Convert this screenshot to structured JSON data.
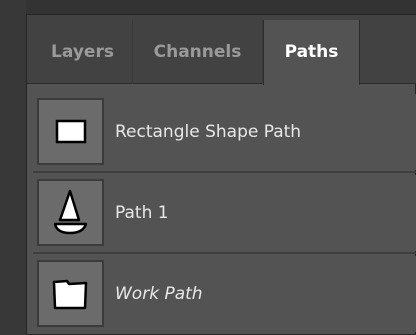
{
  "tabs": [
    {
      "label": "Layers"
    },
    {
      "label": "Channels"
    },
    {
      "label": "Paths"
    }
  ],
  "active_tab": "Paths",
  "paths": [
    {
      "label": "Rectangle Shape Path",
      "icon": "rectangle-path-icon"
    },
    {
      "label": "Path 1",
      "icon": "sailboat-path-icon"
    },
    {
      "label": "Work Path",
      "icon": "work-path-icon"
    }
  ],
  "colors": {
    "panel_bg": "#535353",
    "tabbar_bg": "#424242",
    "thumb_bg": "#6b6b6b",
    "active_tab_text": "#ffffff",
    "inactive_tab_text": "#9a9a9a"
  }
}
